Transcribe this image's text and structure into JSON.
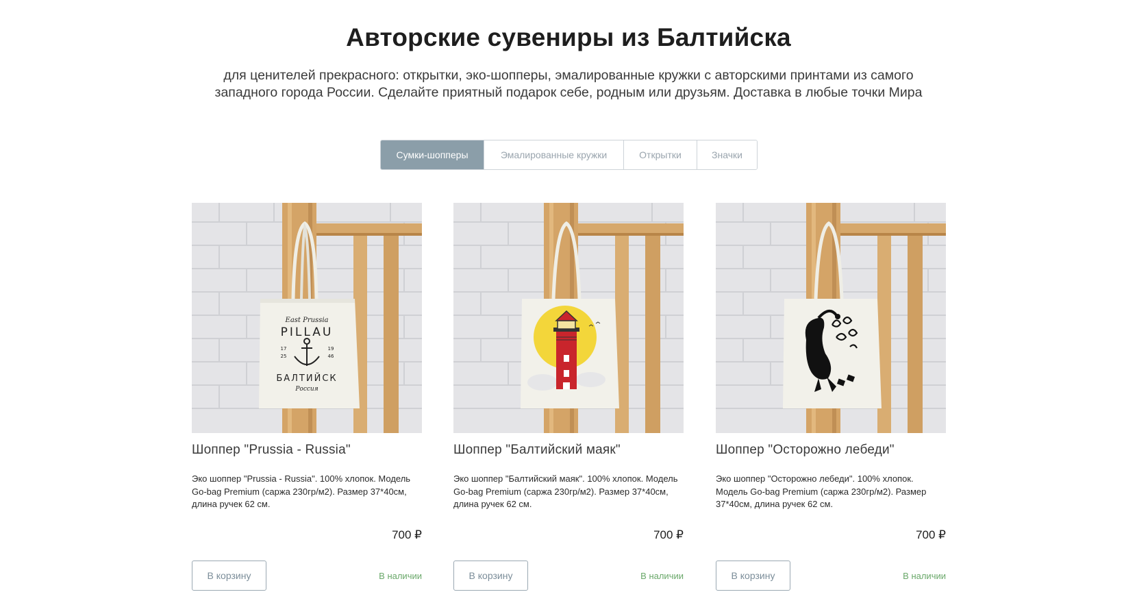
{
  "header": {
    "title": "Авторские сувениры из Балтийска",
    "subtitle_line1": "для ценителей прекрасного: открытки, эко-шопперы, эмалированные кружки с авторскими принтами из самого",
    "subtitle_line2": "западного города России. Сделайте приятный подарок себе, родным или друзьям. Доставка в любые точки Мира"
  },
  "tabs": [
    {
      "label": "Сумки-шопперы",
      "active": true
    },
    {
      "label": "Эмалированные кружки",
      "active": false
    },
    {
      "label": "Открытки",
      "active": false
    },
    {
      "label": "Значки",
      "active": false
    }
  ],
  "products": [
    {
      "title": "Шоппер \"Prussia - Russia\"",
      "desc": "Эко шоппер \"Prussia - Russia\". 100% хлопок. Модель Go-bag Premium (саржа 230гр/м2). Размер 37*40см, длина ручек 62 см.",
      "price": "700 ₽",
      "cart_label": "В корзину",
      "stock": "В наличии",
      "print": {
        "line1": "East Prussia",
        "line2": "PILLAU",
        "year_l_top": "17",
        "year_l_bot": "25",
        "year_r_top": "19",
        "year_r_bot": "46",
        "line3": "БАЛТИЙСК",
        "line4": "Россия"
      }
    },
    {
      "title": "Шоппер \"Балтийский маяк\"",
      "desc": "Эко шоппер \"Балтийский маяк\". 100% хлопок. Модель Go-bag Premium (саржа 230гр/м2). Размер 37*40см, длина ручек 62 см.",
      "price": "700 ₽",
      "cart_label": "В корзину",
      "stock": "В наличии"
    },
    {
      "title": "Шоппер \"Осторожно лебеди\"",
      "desc": "Эко шоппер \"Осторожно лебеди\". 100% хлопок. Модель Go-bag Premium (саржа 230гр/м2). Размер 37*40см, длина ручек 62 см.",
      "price": "700 ₽",
      "cart_label": "В корзину",
      "stock": "В наличии"
    }
  ],
  "colors": {
    "accent": "#8b9ea9",
    "in_stock": "#6aa86a",
    "button_border": "#9aa8b2"
  }
}
